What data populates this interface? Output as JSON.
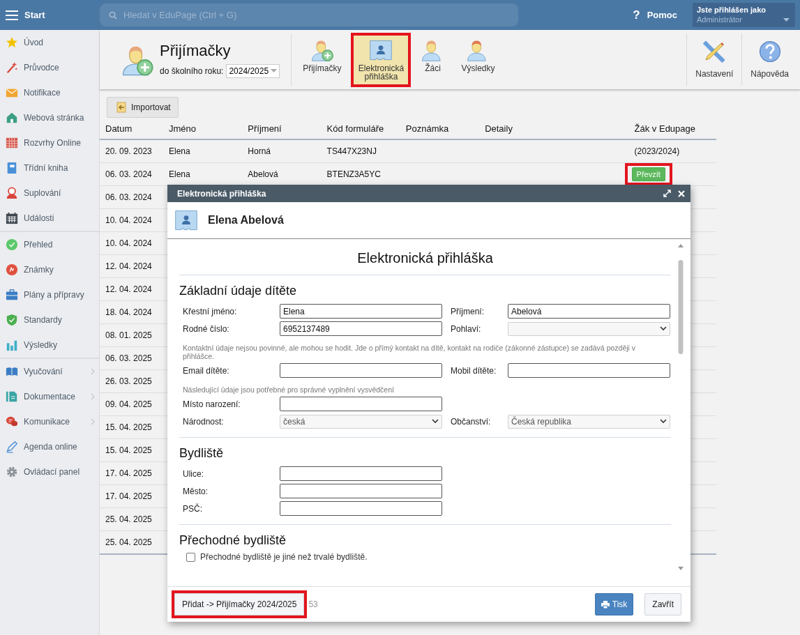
{
  "topbar": {
    "menu_label": "Start",
    "search_placeholder": "Hledat v EduPage (Ctrl + G)",
    "help_icon": "?",
    "help": "Pomoc",
    "user_caption": "Jste přihlášen jako",
    "user_role": "Administrátor"
  },
  "sidebar": {
    "groups": [
      [
        {
          "label": "Úvod",
          "kind": "star",
          "submenu": false
        },
        {
          "label": "Průvodce",
          "kind": "wand",
          "submenu": false
        },
        {
          "label": "Notifikace",
          "kind": "envelope",
          "submenu": false
        },
        {
          "label": "Webová stránka",
          "kind": "house",
          "submenu": false
        },
        {
          "label": "Rozvrhy Online",
          "kind": "timetable",
          "submenu": false
        },
        {
          "label": "Třídní kniha",
          "kind": "notebook",
          "submenu": false
        },
        {
          "label": "Suplování",
          "kind": "person",
          "submenu": false
        },
        {
          "label": "Události",
          "kind": "calendar",
          "submenu": false
        }
      ],
      [
        {
          "label": "Přehled",
          "kind": "check",
          "submenu": false
        },
        {
          "label": "Známky",
          "kind": "grade",
          "submenu": false
        },
        {
          "label": "Plány a přípravy",
          "kind": "briefcase",
          "submenu": false
        },
        {
          "label": "Standardy",
          "kind": "shield",
          "submenu": false
        },
        {
          "label": "Výsledky",
          "kind": "chart",
          "submenu": false
        }
      ],
      [
        {
          "label": "Vyučování",
          "kind": "book",
          "submenu": true
        },
        {
          "label": "Dokumentace",
          "kind": "document",
          "submenu": true
        },
        {
          "label": "Komunikace",
          "kind": "chat",
          "submenu": true
        },
        {
          "label": "Agenda online",
          "kind": "pen",
          "submenu": false
        },
        {
          "label": "Ovládací panel",
          "kind": "gear",
          "submenu": false
        }
      ]
    ]
  },
  "ribbon": {
    "title": "Přijímačky",
    "year_label": "do školního roku:",
    "year": "2024/2025",
    "tabs": [
      {
        "label": "Přijímačky",
        "kind": "person_add",
        "selected": false,
        "highlighted": false
      },
      {
        "label": "Elektronická přihláška",
        "kind": "card",
        "selected": true,
        "highlighted": true
      },
      {
        "label": "Žáci",
        "kind": "person",
        "selected": false,
        "highlighted": false
      },
      {
        "label": "Výsledky",
        "kind": "person_red",
        "selected": false,
        "highlighted": false
      }
    ],
    "tools": [
      {
        "label": "Nastavení",
        "kind": "pencil"
      },
      {
        "label": "Nápověda",
        "kind": "help"
      }
    ]
  },
  "toolbar": {
    "import_button": "Importovat"
  },
  "table": {
    "columns": [
      "Datum",
      "Jméno",
      "Příjmení",
      "Kód formuláře",
      "Poznámka",
      "Detaily",
      "Žák v Edupage"
    ],
    "rows": [
      {
        "date": "20. 09. 2023",
        "first_name": "Elena",
        "last_name": "Horná",
        "form_code": "TS447X23NJ",
        "student": "(2023/2024)"
      },
      {
        "date": "06. 03. 2024",
        "first_name": "Elena",
        "last_name": "Abelová",
        "form_code": "BTENZ3A5YC",
        "action": {
          "label": "Převzít",
          "highlighted": true
        }
      },
      {
        "date": "06. 03. 2024"
      },
      {
        "date": "10. 04. 2024"
      },
      {
        "date": "10. 04. 2024"
      },
      {
        "date": "12. 04. 2024"
      },
      {
        "date": "12. 04. 2024"
      },
      {
        "date": "18. 04. 2024"
      },
      {
        "date": "08. 01. 2025"
      },
      {
        "date": "06. 03. 2025"
      },
      {
        "date": "26. 03. 2025"
      },
      {
        "date": "09. 04. 2025"
      },
      {
        "date": "15. 04. 2025"
      },
      {
        "date": "15. 04. 2025"
      },
      {
        "date": "17. 04. 2025"
      },
      {
        "date": "17. 04. 2025"
      },
      {
        "date": "25. 04. 2025"
      },
      {
        "date": "25. 04. 2025"
      }
    ]
  },
  "dialog": {
    "title": "Elektronická přihláška",
    "person": "Elena Abelová",
    "form_title": "Elektronická přihláška",
    "sections": [
      {
        "heading": "Základní údaje dítěte",
        "items": [
          {
            "kind": "fields",
            "fields": [
              {
                "label": "Křestní jméno:",
                "kind": "text",
                "value": "Elena"
              },
              {
                "label": "Příjmení:",
                "kind": "text",
                "value": "Abelová"
              }
            ]
          },
          {
            "kind": "fields",
            "fields": [
              {
                "label": "Rodné číslo:",
                "kind": "text",
                "value": "6952137489"
              },
              {
                "label": "Pohlaví:",
                "kind": "select"
              }
            ]
          },
          {
            "kind": "note",
            "text": "Kontaktní údaje nejsou povinné, ale mohou se hodit. Jde o přímý kontakt na dítě, kontakt na rodiče (zákonné zástupce) se zadává později v přihlášce."
          },
          {
            "kind": "fields",
            "fields": [
              {
                "label": "Email dítěte:",
                "kind": "text"
              },
              {
                "label": "Mobil dítěte:",
                "kind": "text"
              }
            ]
          },
          {
            "kind": "note",
            "text": "Následující údaje jsou potřebné pro správné vyplnění vysvědčení"
          },
          {
            "kind": "fields",
            "fields": [
              {
                "label": "Místo narození:",
                "kind": "text"
              }
            ]
          },
          {
            "kind": "fields",
            "fields": [
              {
                "label": "Národnost:",
                "kind": "select",
                "value": "česká"
              },
              {
                "label": "Občanství:",
                "kind": "select",
                "value": "Česká republika"
              }
            ]
          }
        ]
      },
      {
        "heading": "Bydliště",
        "items": [
          {
            "kind": "fields",
            "fields": [
              {
                "label": "Ulice:",
                "kind": "text"
              }
            ]
          },
          {
            "kind": "fields",
            "fields": [
              {
                "label": "Město:",
                "kind": "text"
              }
            ]
          },
          {
            "kind": "fields",
            "fields": [
              {
                "label": "PSČ:",
                "kind": "text"
              }
            ]
          }
        ]
      },
      {
        "heading": "Přechodné bydliště",
        "items": [
          {
            "kind": "checkbox",
            "label": "Přechodné bydliště je jiné než trvalé bydliště.",
            "checked": false
          }
        ]
      }
    ],
    "footer": {
      "add_button": {
        "label": "Přidat -> Přijímačky 2024/2025",
        "highlighted": true
      },
      "counter": "53",
      "print_button": "Tisk",
      "close_button": "Zavřít"
    }
  }
}
